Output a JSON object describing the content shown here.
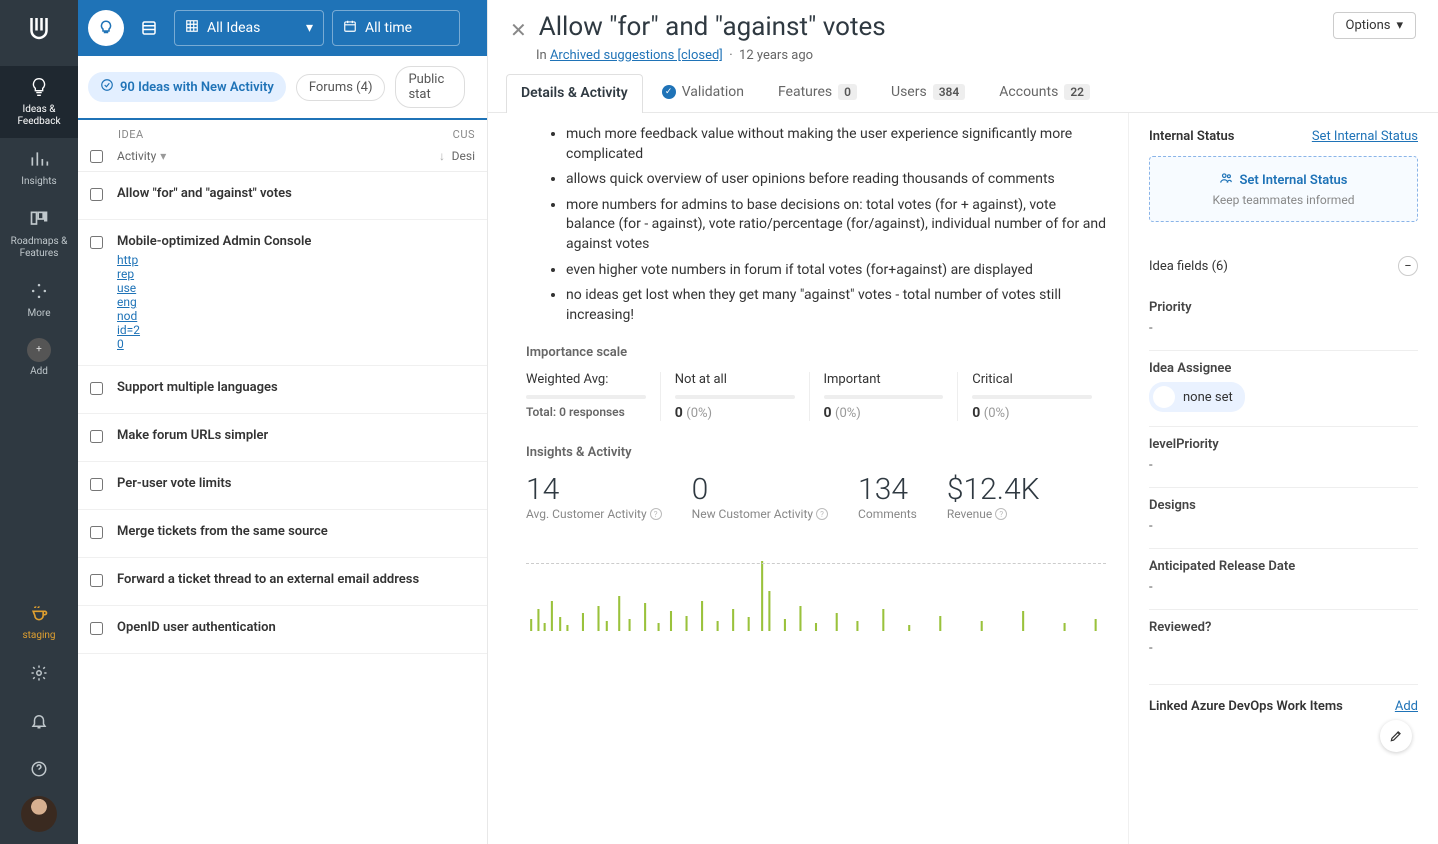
{
  "nav": {
    "items": [
      {
        "label": "Ideas & Feedback"
      },
      {
        "label": "Insights"
      },
      {
        "label": "Roadmaps & Features"
      },
      {
        "label": "More"
      },
      {
        "label": "Add"
      }
    ],
    "staging": "staging"
  },
  "toolbar": {
    "view_select": "All Ideas",
    "time_select": "All time"
  },
  "filters": {
    "primary": "90 Ideas with New Activity",
    "forums": "Forums (4)",
    "statuses": "Public stat"
  },
  "table": {
    "col_idea": "IDEA",
    "col_cust": "CUS",
    "sort_label": "Activity",
    "cust_sub": "Desi"
  },
  "ideas": [
    {
      "title": "Allow \"for\" and \"against\" votes",
      "link": ""
    },
    {
      "title": "Mobile-optimized Admin Console",
      "link": "http\nrep\nuse\neng\nnod\nid=2\n0"
    },
    {
      "title": "Support multiple languages",
      "link": ""
    },
    {
      "title": "Make forum URLs simpler",
      "link": ""
    },
    {
      "title": "Per-user vote limits",
      "link": ""
    },
    {
      "title": "Merge tickets from the same source",
      "link": ""
    },
    {
      "title": "Forward a ticket thread to an external email address",
      "link": ""
    },
    {
      "title": "OpenID user authentication",
      "link": ""
    }
  ],
  "detail": {
    "title": "Allow \"for\" and \"against\" votes",
    "options": "Options",
    "meta_prefix": "In",
    "meta_link": "Archived suggestions [closed]",
    "meta_age": "12 years ago",
    "tabs": {
      "details": "Details & Activity",
      "validation": "Validation",
      "features": "Features",
      "features_n": "0",
      "users": "Users",
      "users_n": "384",
      "accounts": "Accounts",
      "accounts_n": "22"
    },
    "bullets": [
      "much more feedback value without making the user experience significantly more complicated",
      "allows quick overview of user opinions before reading thousands of comments",
      "more numbers for admins to base decisions on: total votes (for + against), vote balance (for - against), vote ratio/percentage (for/against), individual number of for and against votes",
      "even higher vote numbers in forum if total votes (for+against) are displayed",
      "no ideas get lost when they get many \"against\" votes - total number of votes still increasing!"
    ],
    "importance": {
      "heading": "Importance scale",
      "wavg_label": "Weighted Avg:",
      "total_label": "Total: 0 responses",
      "cells": [
        {
          "label": "Not at all",
          "n": "0",
          "pct": "(0%)"
        },
        {
          "label": "Important",
          "n": "0",
          "pct": "(0%)"
        },
        {
          "label": "Critical",
          "n": "0",
          "pct": "(0%)"
        }
      ]
    },
    "insights": {
      "heading": "Insights & Activity",
      "cells": [
        {
          "big": "14",
          "lbl": "Avg. Customer Activity"
        },
        {
          "big": "0",
          "lbl": "New Customer Activity"
        },
        {
          "big": "134",
          "lbl": "Comments"
        },
        {
          "big": "$12.4K",
          "lbl": "Revenue"
        }
      ]
    }
  },
  "right": {
    "status_header": "Internal Status",
    "status_link": "Set Internal Status",
    "status_box_title": "Set Internal Status",
    "status_box_sub": "Keep teammates informed",
    "fields_header": "Idea fields (6)",
    "fields": [
      {
        "label": "Priority",
        "value": "-"
      },
      {
        "label": "Idea Assignee",
        "value": "none set",
        "chip": true
      },
      {
        "label": "levelPriority",
        "value": "-"
      },
      {
        "label": "Designs",
        "value": "-"
      },
      {
        "label": "Anticipated Release Date",
        "value": "-"
      },
      {
        "label": "Reviewed?",
        "value": "-"
      }
    ],
    "linked_header": "Linked Azure DevOps Work Items",
    "linked_add": "Add"
  }
}
